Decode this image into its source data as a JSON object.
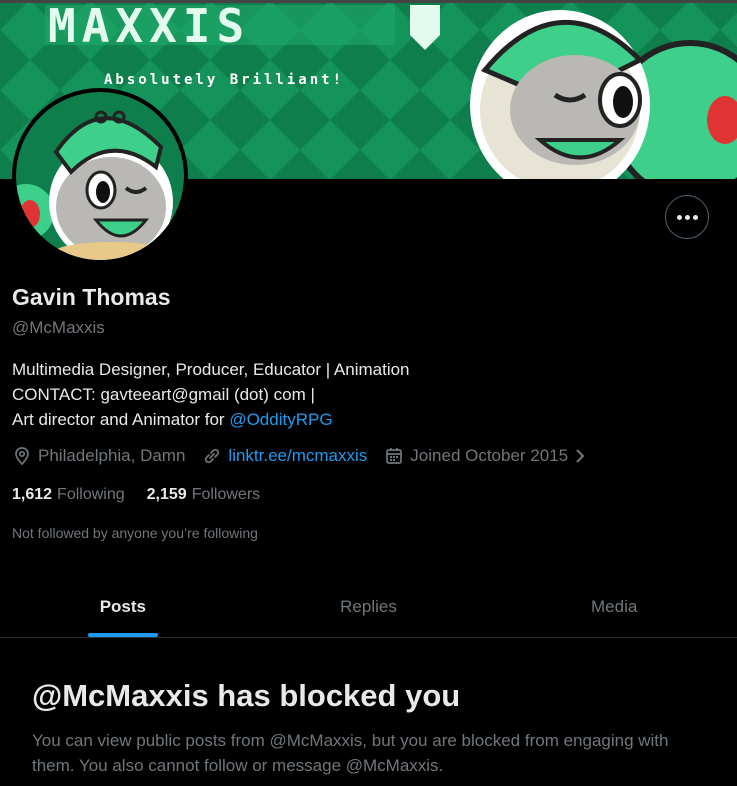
{
  "banner": {
    "logo_text": "MAXXIS",
    "tagline": "Absolutely Brilliant!"
  },
  "profile": {
    "name": "Gavin Thomas",
    "handle": "@McMaxxis",
    "bio_line1": "Multimedia Designer, Producer, Educator | Animation",
    "bio_line2": "CONTACT: gavteeart@gmail (dot) com |",
    "bio_line3_prefix": "Art director and Animator for ",
    "bio_line3_link": "@OddityRPG",
    "location": "Philadelphia, Damn",
    "website": "linktr.ee/mcmaxxis",
    "joined": "Joined October 2015",
    "following_count": "1,612",
    "following_label": "Following",
    "followers_count": "2,159",
    "followers_label": "Followers",
    "not_followed": "Not followed by anyone you’re following"
  },
  "tabs": [
    {
      "label": "Posts",
      "active": true
    },
    {
      "label": "Replies",
      "active": false
    },
    {
      "label": "Media",
      "active": false
    }
  ],
  "blocked": {
    "title": "@McMaxxis has blocked you",
    "text": "You can view public posts from @McMaxxis, but you are blocked from engaging with them. You also cannot follow or message @McMaxxis."
  },
  "colors": {
    "accent": "#1d9bf0",
    "muted": "#71767b",
    "banner_green": "#0f8a56",
    "mascot_green": "#3ed08a"
  },
  "icons": [
    "location-icon",
    "link-icon",
    "calendar-icon",
    "chevron-right-icon",
    "more-icon"
  ]
}
